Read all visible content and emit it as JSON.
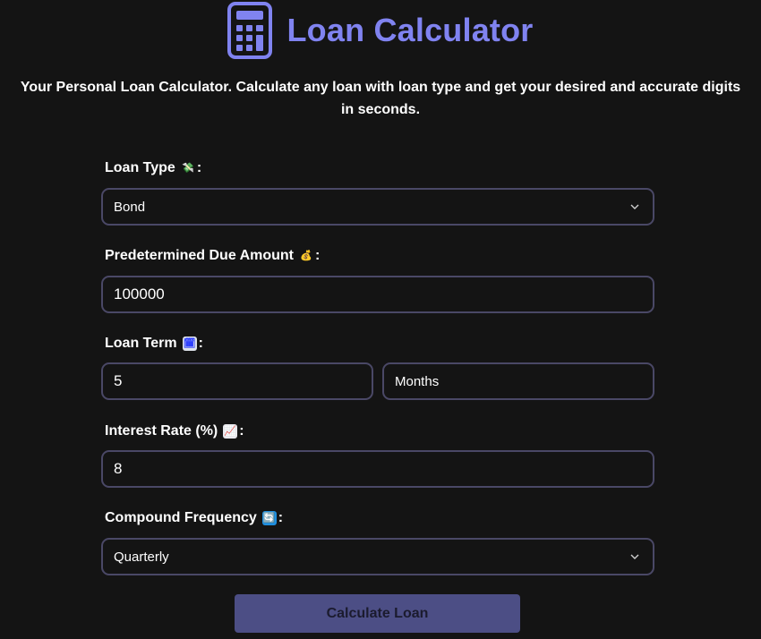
{
  "header": {
    "title": "Loan Calculator",
    "icon": "calculator-icon",
    "accent_color": "#8083f0"
  },
  "subtitle": "Your Personal Loan Calculator. Calculate any loan with loan type and get your desired and accurate digits in seconds.",
  "form": {
    "loan_type": {
      "label": "Loan Type",
      "emoji": "💸",
      "icon": "money-with-wings-icon",
      "value": "Bond"
    },
    "due_amount": {
      "label": "Predetermined Due Amount",
      "emoji": "💰",
      "icon": "money-bag-icon",
      "value": "100000"
    },
    "loan_term": {
      "label": "Loan Term",
      "emoji": "🗓",
      "icon": "calendar-icon",
      "value": "5",
      "unit": "Months"
    },
    "interest_rate": {
      "label": "Interest Rate (%)",
      "emoji": "📈",
      "icon": "chart-increasing-icon",
      "value": "8"
    },
    "compound_frequency": {
      "label": "Compound Frequency",
      "emoji": "🔄",
      "icon": "refresh-arrows-icon",
      "value": "Quarterly"
    },
    "colon": ":"
  },
  "calculate_button": {
    "label": "Calculate Loan",
    "color": "#4c4e85"
  }
}
